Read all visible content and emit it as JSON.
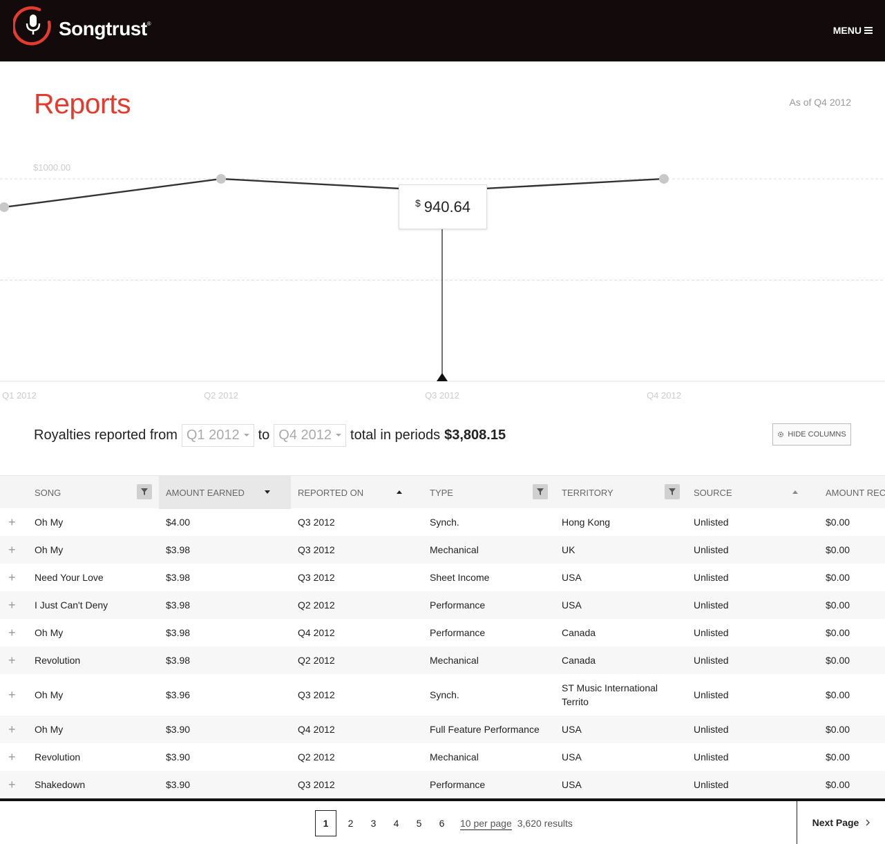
{
  "header": {
    "brand": "Songtrust",
    "brand_mark": "®",
    "menu_label": "MENU",
    "logo_icon": "microphone-icon",
    "menu_icon": "hamburger-icon"
  },
  "page": {
    "title": "Reports",
    "as_of": "As of Q4 2012"
  },
  "chart_data": {
    "type": "line",
    "categories": [
      "Q1 2012",
      "Q2 2012",
      "Q3 2012",
      "Q4 2012"
    ],
    "values": [
      860,
      1000,
      940.64,
      1000
    ],
    "gridlines": [
      1000
    ],
    "gridline_label": "$1000.00",
    "ylim": [
      0,
      1150
    ],
    "highlight_index": 2,
    "tooltip_currency": "$",
    "tooltip_value": "940.64",
    "colors": {
      "line": "#333333",
      "point": "#c8c8c8",
      "highlight": "#222222",
      "grid": "#dddddd",
      "label": "#cccccc"
    }
  },
  "summary": {
    "prefix": "Royalties reported from",
    "from": "Q1 2012",
    "connector": "to",
    "to": "Q4 2012",
    "total_label": "total in periods",
    "total_value": "$3,808.15",
    "hide_columns": "HIDE COLUMNS",
    "hide_columns_icon": "gear-icon"
  },
  "table": {
    "columns": [
      {
        "label": "SONG",
        "control": "filter"
      },
      {
        "label": "AMOUNT EARNED",
        "control": "sort-desc",
        "active": true
      },
      {
        "label": "REPORTED ON",
        "control": "sort-asc"
      },
      {
        "label": "TYPE",
        "control": "filter"
      },
      {
        "label": "TERRITORY",
        "control": "filter"
      },
      {
        "label": "SOURCE",
        "control": "sort-asc-light"
      },
      {
        "label": "AMOUNT RECEIVED",
        "control": "none"
      }
    ],
    "rows": [
      [
        "Oh My",
        "$4.00",
        "Q3 2012",
        "Synch.",
        "Hong Kong",
        "Unlisted",
        "$0.00"
      ],
      [
        "Oh My",
        "$3.98",
        "Q3 2012",
        "Mechanical",
        "UK",
        "Unlisted",
        "$0.00"
      ],
      [
        "Need Your Love",
        "$3.98",
        "Q3 2012",
        "Sheet Income",
        "USA",
        "Unlisted",
        "$0.00"
      ],
      [
        "I Just Can't Deny",
        "$3.98",
        "Q2 2012",
        "Performance",
        "USA",
        "Unlisted",
        "$0.00"
      ],
      [
        "Oh My",
        "$3.98",
        "Q4 2012",
        "Performance",
        "Canada",
        "Unlisted",
        "$0.00"
      ],
      [
        "Revolution",
        "$3.98",
        "Q2 2012",
        "Mechanical",
        "Canada",
        "Unlisted",
        "$0.00"
      ],
      [
        "Oh My",
        "$3.96",
        "Q3 2012",
        "Synch.",
        "ST Music International Territo",
        "Unlisted",
        "$0.00"
      ],
      [
        "Oh My",
        "$3.90",
        "Q4 2012",
        "Full Feature Performance",
        "USA",
        "Unlisted",
        "$0.00"
      ],
      [
        "Revolution",
        "$3.90",
        "Q2 2012",
        "Mechanical",
        "USA",
        "Unlisted",
        "$0.00"
      ],
      [
        "Shakedown",
        "$3.90",
        "Q3 2012",
        "Performance",
        "USA",
        "Unlisted",
        "$0.00"
      ]
    ],
    "expand_icon": "plus-icon"
  },
  "pagination": {
    "pages": [
      "1",
      "2",
      "3",
      "4",
      "5",
      "6"
    ],
    "current": "1",
    "per_page": "10 per page",
    "results": "3,620 results",
    "next": "Next Page",
    "next_icon": "chevron-right-icon"
  },
  "colors": {
    "brand_red": "#e33b2e",
    "header_bg": "#130b0b"
  }
}
